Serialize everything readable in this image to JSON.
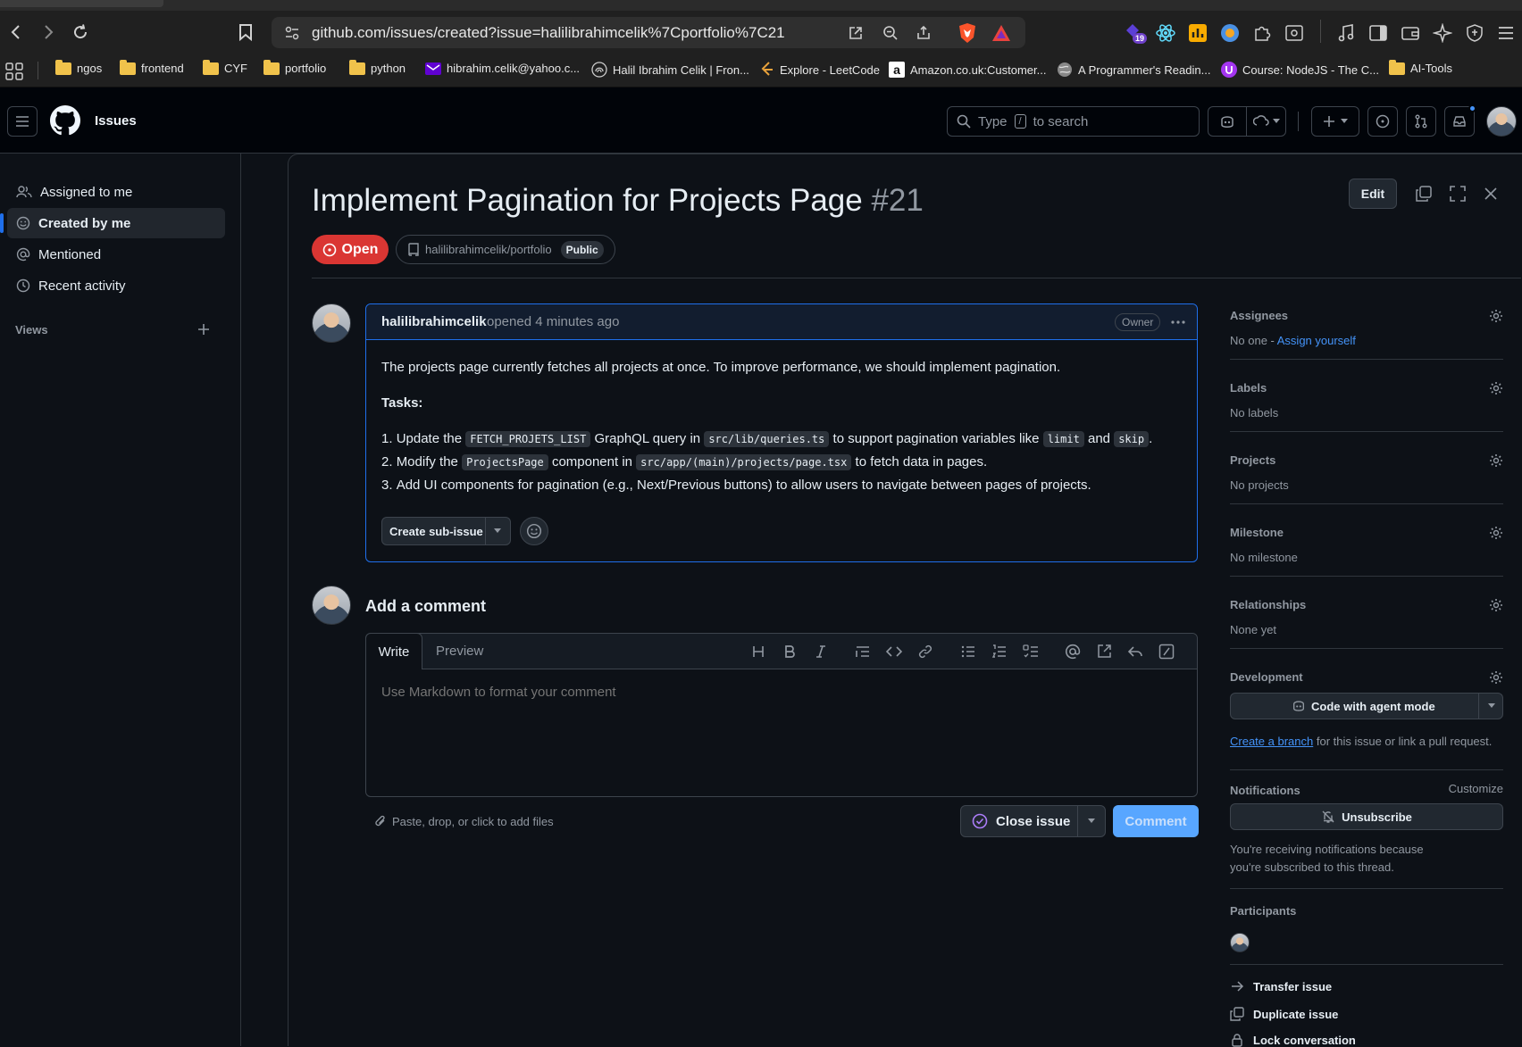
{
  "browser": {
    "url": "github.com/issues/created?issue=halilibrahimcelik%7Cportfolio%7C21",
    "extension_badge": "19",
    "bookmarks": [
      {
        "label": "ngos",
        "icon": "folder-icon"
      },
      {
        "label": "frontend",
        "icon": "folder-icon"
      },
      {
        "label": "CYF",
        "icon": "folder-icon"
      },
      {
        "label": "portfolio",
        "icon": "folder-icon"
      },
      {
        "label": "python",
        "icon": "folder-icon"
      },
      {
        "label": "hibrahim.celik@yahoo.c...",
        "icon": "mail-icon"
      },
      {
        "label": "Halil Ibrahim Celik | Fron...",
        "icon": "fingerprint-icon"
      },
      {
        "label": "Explore - LeetCode",
        "icon": "leetcode-icon"
      },
      {
        "label": "Amazon.co.uk:Customer...",
        "icon": "amazon-icon"
      },
      {
        "label": "A Programmer's Readin...",
        "icon": "globe-icon"
      },
      {
        "label": "Course: NodeJS - The C...",
        "icon": "udemy-icon"
      },
      {
        "label": "AI-Tools",
        "icon": "folder-icon"
      }
    ]
  },
  "header": {
    "context": "Issues",
    "search_placeholder_prefix": "Type",
    "search_key": "/",
    "search_placeholder_suffix": "to search"
  },
  "sidebar": {
    "items": [
      {
        "label": "Assigned to me",
        "icon": "people-icon",
        "active": false
      },
      {
        "label": "Created by me",
        "icon": "smiley-icon",
        "active": true
      },
      {
        "label": "Mentioned",
        "icon": "mention-icon",
        "active": false
      },
      {
        "label": "Recent activity",
        "icon": "clock-icon",
        "active": false
      }
    ],
    "views_label": "Views"
  },
  "issue": {
    "title": "Implement Pagination for Projects Page",
    "number": "#21",
    "state": "Open",
    "repo": "halilibrahimcelik/portfolio",
    "visibility": "Public",
    "edit_label": "Edit",
    "author": "halilibrahimcelik",
    "opened_text": "opened 4 minutes ago",
    "author_role": "Owner",
    "body": {
      "intro": "The projects page currently fetches all projects at once. To improve performance, we should implement pagination.",
      "tasks_heading": "Tasks:",
      "task1": {
        "a": "Update the",
        "code1": "FETCH_PROJETS_LIST",
        "b": "GraphQL query in",
        "code2": "src/lib/queries.ts",
        "c": "to support pagination variables like",
        "code3": "limit",
        "d": "and",
        "code4": "skip",
        "e": "."
      },
      "task2": {
        "a": "Modify the",
        "code1": "ProjectsPage",
        "b": "component in",
        "code2": "src/app/(main)/projects/page.tsx",
        "c": "to fetch data in pages."
      },
      "task3": "Add UI components for pagination (e.g., Next/Previous buttons) to allow users to navigate between pages of projects."
    },
    "create_subissue_label": "Create sub-issue"
  },
  "comment_form": {
    "heading": "Add a comment",
    "tab_write": "Write",
    "tab_preview": "Preview",
    "placeholder": "Use Markdown to format your comment",
    "attach_hint": "Paste, drop, or click to add files",
    "close_issue_label": "Close issue",
    "comment_label": "Comment"
  },
  "right_sidebar": {
    "assignees_title": "Assignees",
    "assignees_value": "No one - ",
    "assign_yourself": "Assign yourself",
    "labels_title": "Labels",
    "labels_value": "No labels",
    "projects_title": "Projects",
    "projects_value": "No projects",
    "milestone_title": "Milestone",
    "milestone_value": "No milestone",
    "relationships_title": "Relationships",
    "relationships_value": "None yet",
    "development_title": "Development",
    "code_agent_label": "Code with agent mode",
    "create_branch_link": "Create a branch",
    "create_branch_suffix": " for this issue or link a pull request.",
    "notifications_title": "Notifications",
    "customize_label": "Customize",
    "unsubscribe_label": "Unsubscribe",
    "notifications_reason": "You're receiving notifications because you're subscribed to this thread.",
    "participants_title": "Participants",
    "transfer_label": "Transfer issue",
    "duplicate_label": "Duplicate issue",
    "lock_label": "Lock conversation"
  },
  "colors": {
    "open_badge": "#da3633",
    "accent_blue": "#1f6feb",
    "link": "#4493f8",
    "comment_button": "#58a6ff"
  }
}
